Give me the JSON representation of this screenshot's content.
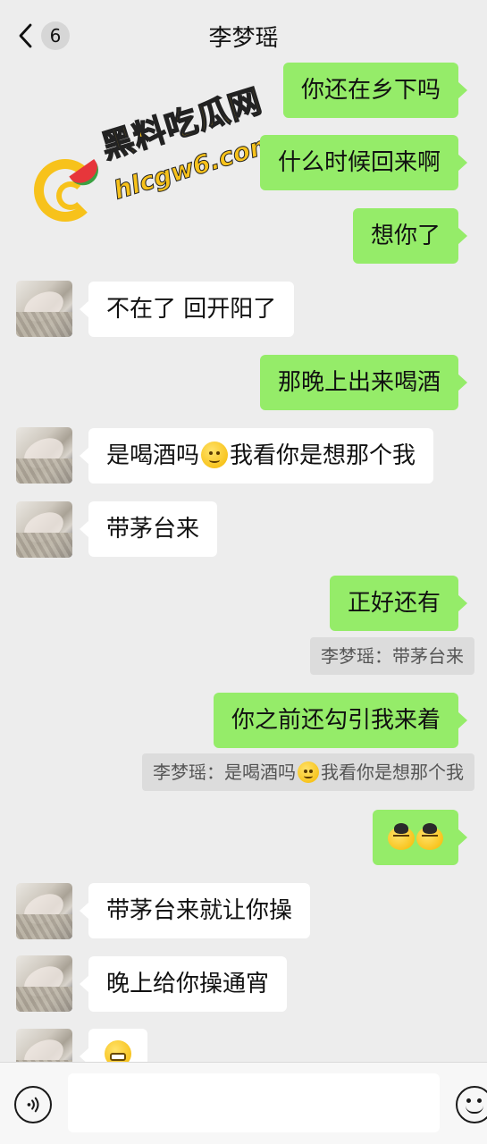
{
  "header": {
    "back_icon": "chevron-left-icon",
    "unread_count": "6",
    "title": "李梦瑶"
  },
  "watermark": {
    "site_name": "黑料吃瓜网",
    "url": "hlcgw6.com"
  },
  "messages": [
    {
      "side": "right",
      "text": "你还在乡下吗"
    },
    {
      "side": "right",
      "text": "什么时候回来啊"
    },
    {
      "side": "right",
      "text": "想你了"
    },
    {
      "side": "left",
      "text": "不在了 回开阳了"
    },
    {
      "side": "right",
      "text": "那晚上出来喝酒"
    },
    {
      "side": "left",
      "text_before": "是喝酒吗",
      "emoji": "smile-emoji",
      "text_after": "我看你是想那个我"
    },
    {
      "side": "left",
      "text": "带茅台来"
    },
    {
      "side": "right",
      "text": "正好还有",
      "quote": "李梦瑶：带茅台来"
    },
    {
      "side": "right",
      "text": "你之前还勾引我来着",
      "quote_before": "李梦瑶：是喝酒吗",
      "quote_emoji": "smile-emoji",
      "quote_after": "我看你是想那个我"
    },
    {
      "side": "right",
      "emoji": [
        "facepalm-emoji",
        "facepalm-emoji"
      ]
    },
    {
      "side": "left",
      "text": "带茅台来就让你操"
    },
    {
      "side": "left",
      "text": "晚上给你操通宵"
    },
    {
      "side": "left",
      "emoji": "grin-emoji"
    }
  ],
  "input_bar": {
    "voice_icon": "voice-icon",
    "text_value": "",
    "emoji_icon": "emoji-icon"
  },
  "colors": {
    "background": "#ededed",
    "outgoing_bubble": "#95ec69",
    "incoming_bubble": "#ffffff",
    "watermark": "#f7c21b"
  }
}
